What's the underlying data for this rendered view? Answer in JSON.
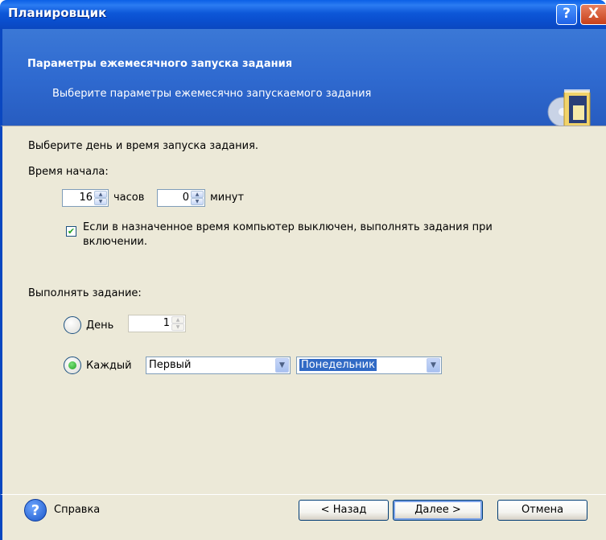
{
  "window": {
    "title": "Планировщик",
    "help_button": "?",
    "close_button": "X"
  },
  "header": {
    "title": "Параметры ежемесячного запуска задания",
    "subtitle": "Выберите параметры ежемесячно запускаемого задания"
  },
  "content": {
    "intro": "Выберите день и время запуска задания.",
    "start_time_label": "Время начала:",
    "hours_value": "16",
    "hours_label": "часов",
    "minutes_value": "0",
    "minutes_label": "минут",
    "run_if_off_checked": true,
    "run_if_off_line1": "Если в назначенное время компьютер выключен, выполнять задания при",
    "run_if_off_line2": "включении.",
    "run_task_label": "Выполнять задание:",
    "day_option_label": "День",
    "day_value": "1",
    "day_selected": false,
    "every_option_label": "Каждый",
    "every_selected": true,
    "week_select_value": "Первый",
    "weekday_select_value": "Понедельник"
  },
  "footer": {
    "help_label": "Справка",
    "back_label": "< Назад",
    "next_label": "Далее >",
    "cancel_label": "Отмена"
  },
  "colors": {
    "titlebar": "#0a4fcf",
    "header": "#2f6ad0",
    "dialog_bg": "#ece9d8",
    "selection": "#316ac5"
  }
}
